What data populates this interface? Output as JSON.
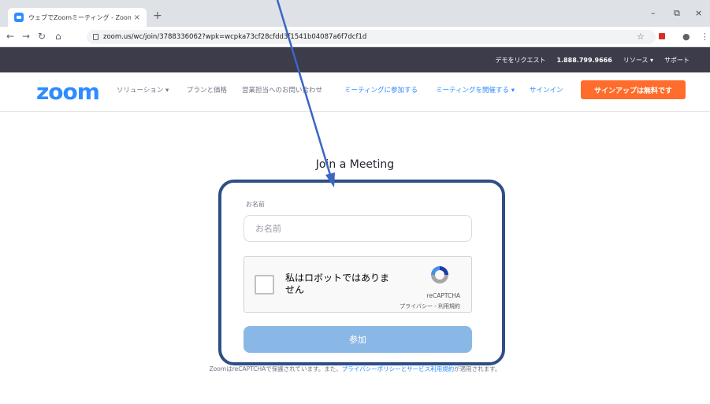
{
  "browser": {
    "tab_title": "ウェブでZoomミーティング - Zoom",
    "tab_close": "×",
    "new_tab": "+",
    "url": "zoom.us/wc/join/3788336062?wpk=wcpka73cf28cfdd3f1541b04087a6f7dcf1d",
    "window_controls": [
      "–",
      "⧉",
      "×"
    ],
    "nav_icons": [
      "back-icon",
      "forward-icon",
      "reload-icon",
      "home-icon"
    ]
  },
  "topbar": {
    "request_demo": "デモをリクエスト",
    "phone": "1.888.799.9666",
    "resources": "リソース ▾",
    "support": "サポート"
  },
  "navbar": {
    "logo": "zoom",
    "solutions": "ソリューション ▾",
    "plans": "プランと価格",
    "contact_sales": "営業担当へのお問い合わせ",
    "join_meeting": "ミーティングに参加する",
    "host_meeting": "ミーティングを開催する ▾",
    "sign_in": "サインイン",
    "sign_up": "サインアップは無料です"
  },
  "main": {
    "heading": "Join a Meeting",
    "name_label": "お名前",
    "name_placeholder": "お名前",
    "recaptcha": {
      "text": "私はロボットではありません",
      "brand": "reCAPTCHA",
      "terms": "プライバシー - 利用規約"
    },
    "join_button": "参加",
    "footer_prefix": "ZoomはreCAPTCHAで保護されています。また、",
    "footer_link": "プライバシーポリシーとサービス利用規約",
    "footer_suffix": "が適用されます。"
  },
  "colors": {
    "zoom_blue": "#2d8cff",
    "signup_orange": "#ff6c2c",
    "topbar_dark": "#3d3c4b",
    "join_button": "#8ab8e6",
    "annotation": "#2f4e84"
  }
}
